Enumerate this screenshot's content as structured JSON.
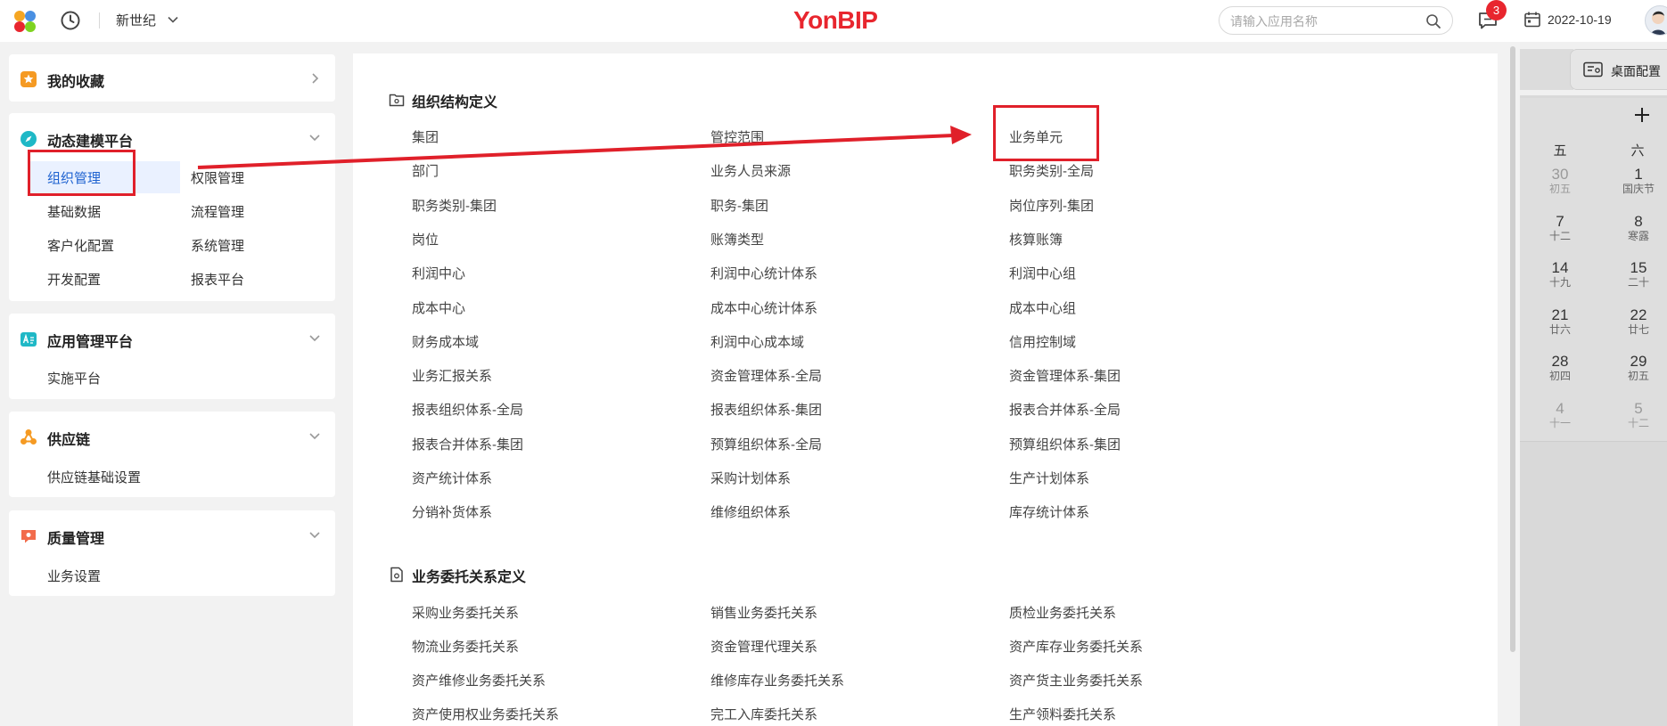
{
  "header": {
    "tenant": "新世纪",
    "brand": "YonBIP",
    "search_placeholder": "请输入应用名称",
    "notification_count": "3",
    "date": "2022-10-19",
    "brand_color": "#e8262e"
  },
  "sidebar": {
    "favorites": {
      "title": "我的收藏",
      "icon": "star-icon"
    },
    "modeling": {
      "title": "动态建模平台",
      "icon": "compass-icon",
      "items": [
        "组织管理",
        "权限管理",
        "基础数据",
        "流程管理",
        "客户化配置",
        "系统管理",
        "开发配置",
        "报表平台"
      ],
      "active": "组织管理"
    },
    "app_mgmt": {
      "title": "应用管理平台",
      "icon": "app-icon",
      "items": [
        "实施平台"
      ]
    },
    "supply": {
      "title": "供应链",
      "icon": "chain-icon",
      "items": [
        "供应链基础设置"
      ]
    },
    "quality": {
      "title": "质量管理",
      "icon": "quality-icon",
      "items": [
        "业务设置"
      ]
    }
  },
  "main": {
    "sections": [
      {
        "title": "组织结构定义",
        "rows": [
          [
            "集团",
            "管控范围",
            "业务单元"
          ],
          [
            "部门",
            "业务人员来源",
            "职务类别-全局"
          ],
          [
            "职务类别-集团",
            "职务-集团",
            "岗位序列-集团"
          ],
          [
            "岗位",
            "账簿类型",
            "核算账簿"
          ],
          [
            "利润中心",
            "利润中心统计体系",
            "利润中心组"
          ],
          [
            "成本中心",
            "成本中心统计体系",
            "成本中心组"
          ],
          [
            "财务成本域",
            "利润中心成本域",
            "信用控制域"
          ],
          [
            "业务汇报关系",
            "资金管理体系-全局",
            "资金管理体系-集团"
          ],
          [
            "报表组织体系-全局",
            "报表组织体系-集团",
            "报表合并体系-全局"
          ],
          [
            "报表合并体系-集团",
            "预算组织体系-全局",
            "预算组织体系-集团"
          ],
          [
            "资产统计体系",
            "采购计划体系",
            "生产计划体系"
          ],
          [
            "分销补货体系",
            "维修组织体系",
            "库存统计体系"
          ]
        ]
      },
      {
        "title": "业务委托关系定义",
        "rows": [
          [
            "采购业务委托关系",
            "销售业务委托关系",
            "质检业务委托关系"
          ],
          [
            "物流业务委托关系",
            "资金管理代理关系",
            "资产库存业务委托关系"
          ],
          [
            "资产维修业务委托关系",
            "维修库存业务委托关系",
            "资产货主业务委托关系"
          ],
          [
            "资产使用权业务委托关系",
            "完工入库委托关系",
            "生产领料委托关系"
          ]
        ]
      }
    ]
  },
  "right_panel": {
    "desk_config": "桌面配置",
    "weekdays": [
      "五",
      "六"
    ],
    "days": [
      [
        {
          "n": "30",
          "l": "初五"
        },
        {
          "n": "1",
          "l": "国庆节"
        }
      ],
      [
        {
          "n": "7",
          "l": "十二"
        },
        {
          "n": "8",
          "l": "寒露"
        }
      ],
      [
        {
          "n": "14",
          "l": "十九"
        },
        {
          "n": "15",
          "l": "二十"
        }
      ],
      [
        {
          "n": "21",
          "l": "廿六"
        },
        {
          "n": "22",
          "l": "廿七"
        }
      ],
      [
        {
          "n": "28",
          "l": "初四"
        },
        {
          "n": "29",
          "l": "初五"
        }
      ],
      [
        {
          "n": "4",
          "l": "十一"
        },
        {
          "n": "5",
          "l": "十二"
        }
      ]
    ]
  }
}
